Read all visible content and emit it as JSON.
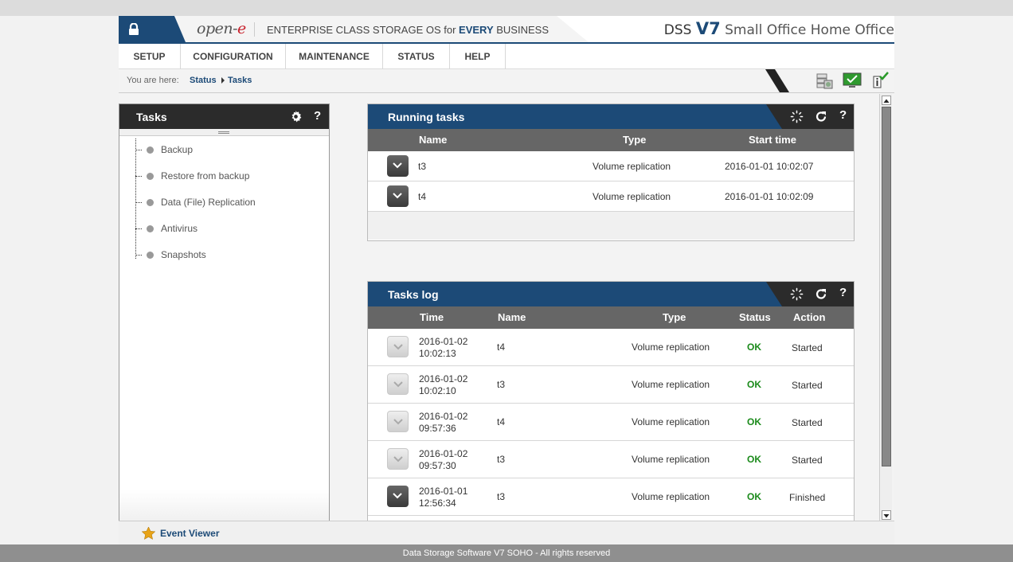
{
  "header": {
    "brand_prefix": "open-",
    "brand_suffix": "e",
    "tagline_pre": "ENTERPRISE CLASS STORAGE OS for ",
    "tagline_bold": "EVERY",
    "tagline_post": " BUSINESS",
    "product_dss": "DSS ",
    "product_v7": "V7",
    "product_name": " Small Office Home Office"
  },
  "nav": {
    "items": [
      {
        "label": "SETUP"
      },
      {
        "label": "CONFIGURATION"
      },
      {
        "label": "MAINTENANCE"
      },
      {
        "label": "STATUS"
      },
      {
        "label": "HELP"
      }
    ]
  },
  "breadcrumb": {
    "prefix": "You are here:",
    "items": [
      "Status",
      "Tasks"
    ]
  },
  "sidebar": {
    "title": "Tasks",
    "items": [
      {
        "label": "Backup"
      },
      {
        "label": "Restore from backup"
      },
      {
        "label": "Data (File) Replication"
      },
      {
        "label": "Antivirus"
      },
      {
        "label": "Snapshots"
      }
    ]
  },
  "running_tasks": {
    "title": "Running tasks",
    "columns": [
      "Name",
      "Type",
      "Start time"
    ],
    "rows": [
      {
        "name": "t3",
        "type": "Volume replication",
        "start": "2016-01-01 10:02:07"
      },
      {
        "name": "t4",
        "type": "Volume replication",
        "start": "2016-01-01 10:02:09"
      }
    ]
  },
  "tasks_log": {
    "title": "Tasks log",
    "columns": [
      "Time",
      "Name",
      "Type",
      "Status",
      "Action"
    ],
    "rows": [
      {
        "date": "2016-01-02",
        "time": "10:02:13",
        "name": "t4",
        "type": "Volume replication",
        "status": "OK",
        "action": "Started"
      },
      {
        "date": "2016-01-02",
        "time": "10:02:10",
        "name": "t3",
        "type": "Volume replication",
        "status": "OK",
        "action": "Started"
      },
      {
        "date": "2016-01-02",
        "time": "09:57:36",
        "name": "t4",
        "type": "Volume replication",
        "status": "OK",
        "action": "Started"
      },
      {
        "date": "2016-01-02",
        "time": "09:57:30",
        "name": "t3",
        "type": "Volume replication",
        "status": "OK",
        "action": "Started"
      },
      {
        "date": "2016-01-01",
        "time": "12:56:34",
        "name": "t3",
        "type": "Volume replication",
        "status": "OK",
        "action": "Finished"
      }
    ]
  },
  "event_viewer": {
    "label": "Event Viewer"
  },
  "footer": {
    "text": "Data Storage Software V7 SOHO - All rights reserved"
  },
  "colors": {
    "brand_blue": "#1c4a77",
    "ok_green": "#1a8a1a",
    "brand_red": "#c8202b"
  }
}
